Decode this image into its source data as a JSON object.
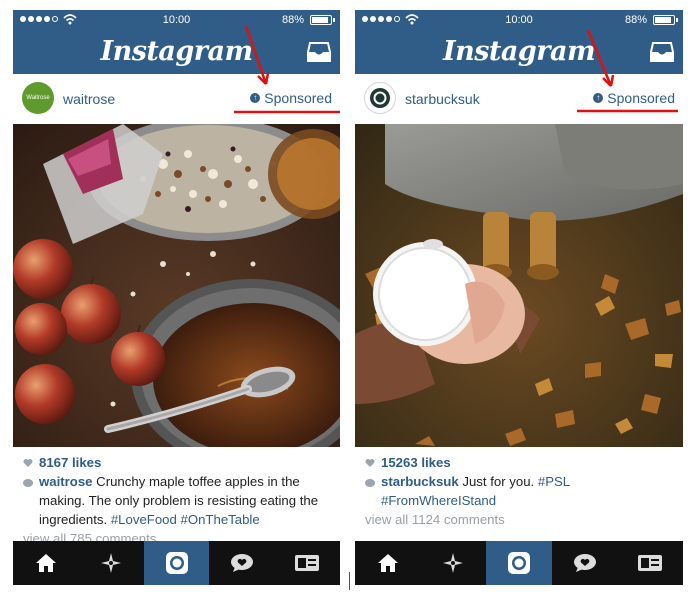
{
  "status_bar": {
    "time": "10:00",
    "battery": "88%",
    "battery_level": 0.88
  },
  "header": {
    "logo": "Instagram"
  },
  "posts": [
    {
      "username": "waitrose",
      "avatar_text": "Waitrose",
      "sponsored_label": "Sponsored",
      "likes": "8167 likes",
      "caption_user": "waitrose",
      "caption_text": " Crunchy maple toffee apples in the making. The only problem is resisting eating the ingredients. ",
      "caption_tags": "#LoveFood #OnTheTable",
      "comments_link": "view all 785 comments",
      "photo": "bowls of maple toffee ingredients, spoon and red apples on dark wood"
    },
    {
      "username": "starbucksuk",
      "avatar_text": "",
      "sponsored_label": "Sponsored",
      "likes": "15263 likes",
      "caption_user": "starbucksuk",
      "caption_text": " Just for you. ",
      "caption_tags": "#PSL #FromWhereIStand",
      "comments_link": "view all 1124 comments",
      "photo": "hands holding a white coffee cup over autumn leaves"
    }
  ],
  "tabs": [
    {
      "name": "home",
      "icon": "home-icon",
      "active": false
    },
    {
      "name": "explore",
      "icon": "explore-star-icon",
      "active": false
    },
    {
      "name": "camera",
      "icon": "camera-icon",
      "active": true
    },
    {
      "name": "activity",
      "icon": "activity-bubble-icon",
      "active": false
    },
    {
      "name": "profile",
      "icon": "profile-card-icon",
      "active": false
    }
  ],
  "colors": {
    "header": "#2f5d87",
    "link": "#2f5d87",
    "tabbar": "#111111",
    "annotation": "#e01010"
  }
}
